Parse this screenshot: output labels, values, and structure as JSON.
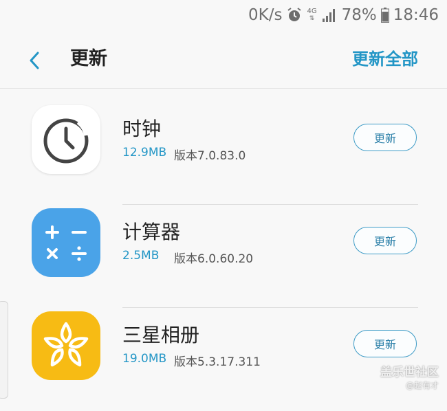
{
  "status_bar": {
    "network_speed": "0K/s",
    "network_type": "4G",
    "battery_percent": "78%",
    "time": "18:46",
    "icons": [
      "alarm-icon",
      "signal-icon",
      "battery-icon"
    ]
  },
  "header": {
    "title": "更新",
    "update_all_label": "更新全部"
  },
  "apps": [
    {
      "name": "时钟",
      "size": "12.9MB",
      "version": "版本7.0.83.0",
      "button": "更新",
      "icon": "clock-app-icon",
      "color": "#ffffff"
    },
    {
      "name": "计算器",
      "size": "2.5MB",
      "version": "版本6.0.60.20",
      "button": "更新",
      "icon": "calculator-app-icon",
      "color": "#4aa3e8"
    },
    {
      "name": "三星相册",
      "size": "19.0MB",
      "version": "版本5.3.17.311",
      "button": "更新",
      "icon": "gallery-app-icon",
      "color": "#f7bb14"
    }
  ],
  "watermark": {
    "line1": "盖乐世社区",
    "line2": "@赵有才"
  },
  "colors": {
    "accent": "#2396c6",
    "background": "#f8f8f8"
  }
}
